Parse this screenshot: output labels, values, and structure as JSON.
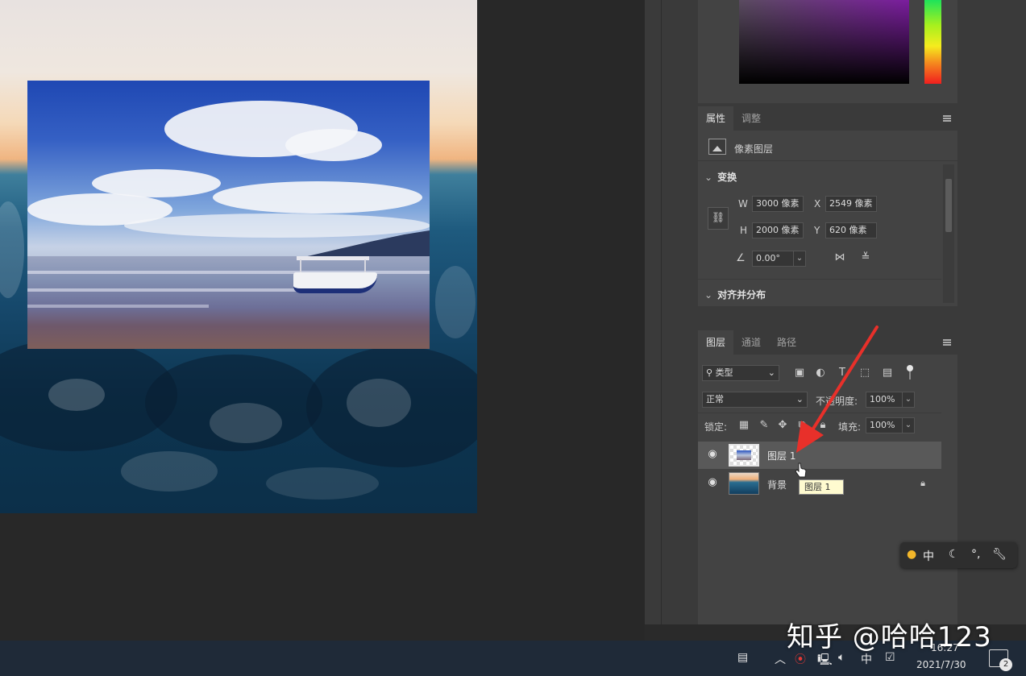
{
  "properties_panel": {
    "tabs": [
      {
        "label": "属性",
        "active": true
      },
      {
        "label": "调整",
        "active": false
      }
    ],
    "layer_type": "像素图层",
    "transform": {
      "header": "变换",
      "w_label": "W",
      "w_value": "3000 像素",
      "h_label": "H",
      "h_value": "2000 像素",
      "x_label": "X",
      "x_value": "2549 像素",
      "y_label": "Y",
      "y_value": "620 像素",
      "angle_value": "0.00°"
    },
    "align_header": "对齐并分布"
  },
  "layers_panel": {
    "tabs": [
      {
        "label": "图层",
        "active": true
      },
      {
        "label": "通道",
        "active": false
      },
      {
        "label": "路径",
        "active": false
      }
    ],
    "filter_kind": "类型",
    "blend_mode": "正常",
    "opacity_label": "不透明度:",
    "opacity_value": "100%",
    "lock_label": "锁定:",
    "fill_label": "填充:",
    "fill_value": "100%",
    "layers": [
      {
        "name": "图层 1",
        "selected": true,
        "visible": true,
        "locked": false
      },
      {
        "name": "背景",
        "selected": false,
        "visible": true,
        "locked": true
      }
    ],
    "tooltip": "图层 1"
  },
  "ime_bar": {
    "mode": "中"
  },
  "taskbar": {
    "input_method": "中",
    "time": "16:27",
    "date": "2021/7/30",
    "notification_count": "2"
  },
  "watermark": "知乎 @哈哈123",
  "colors": {
    "accent_arrow": "#e8302a",
    "panel_bg": "#434343",
    "tab_bar": "#3a3a3a"
  }
}
